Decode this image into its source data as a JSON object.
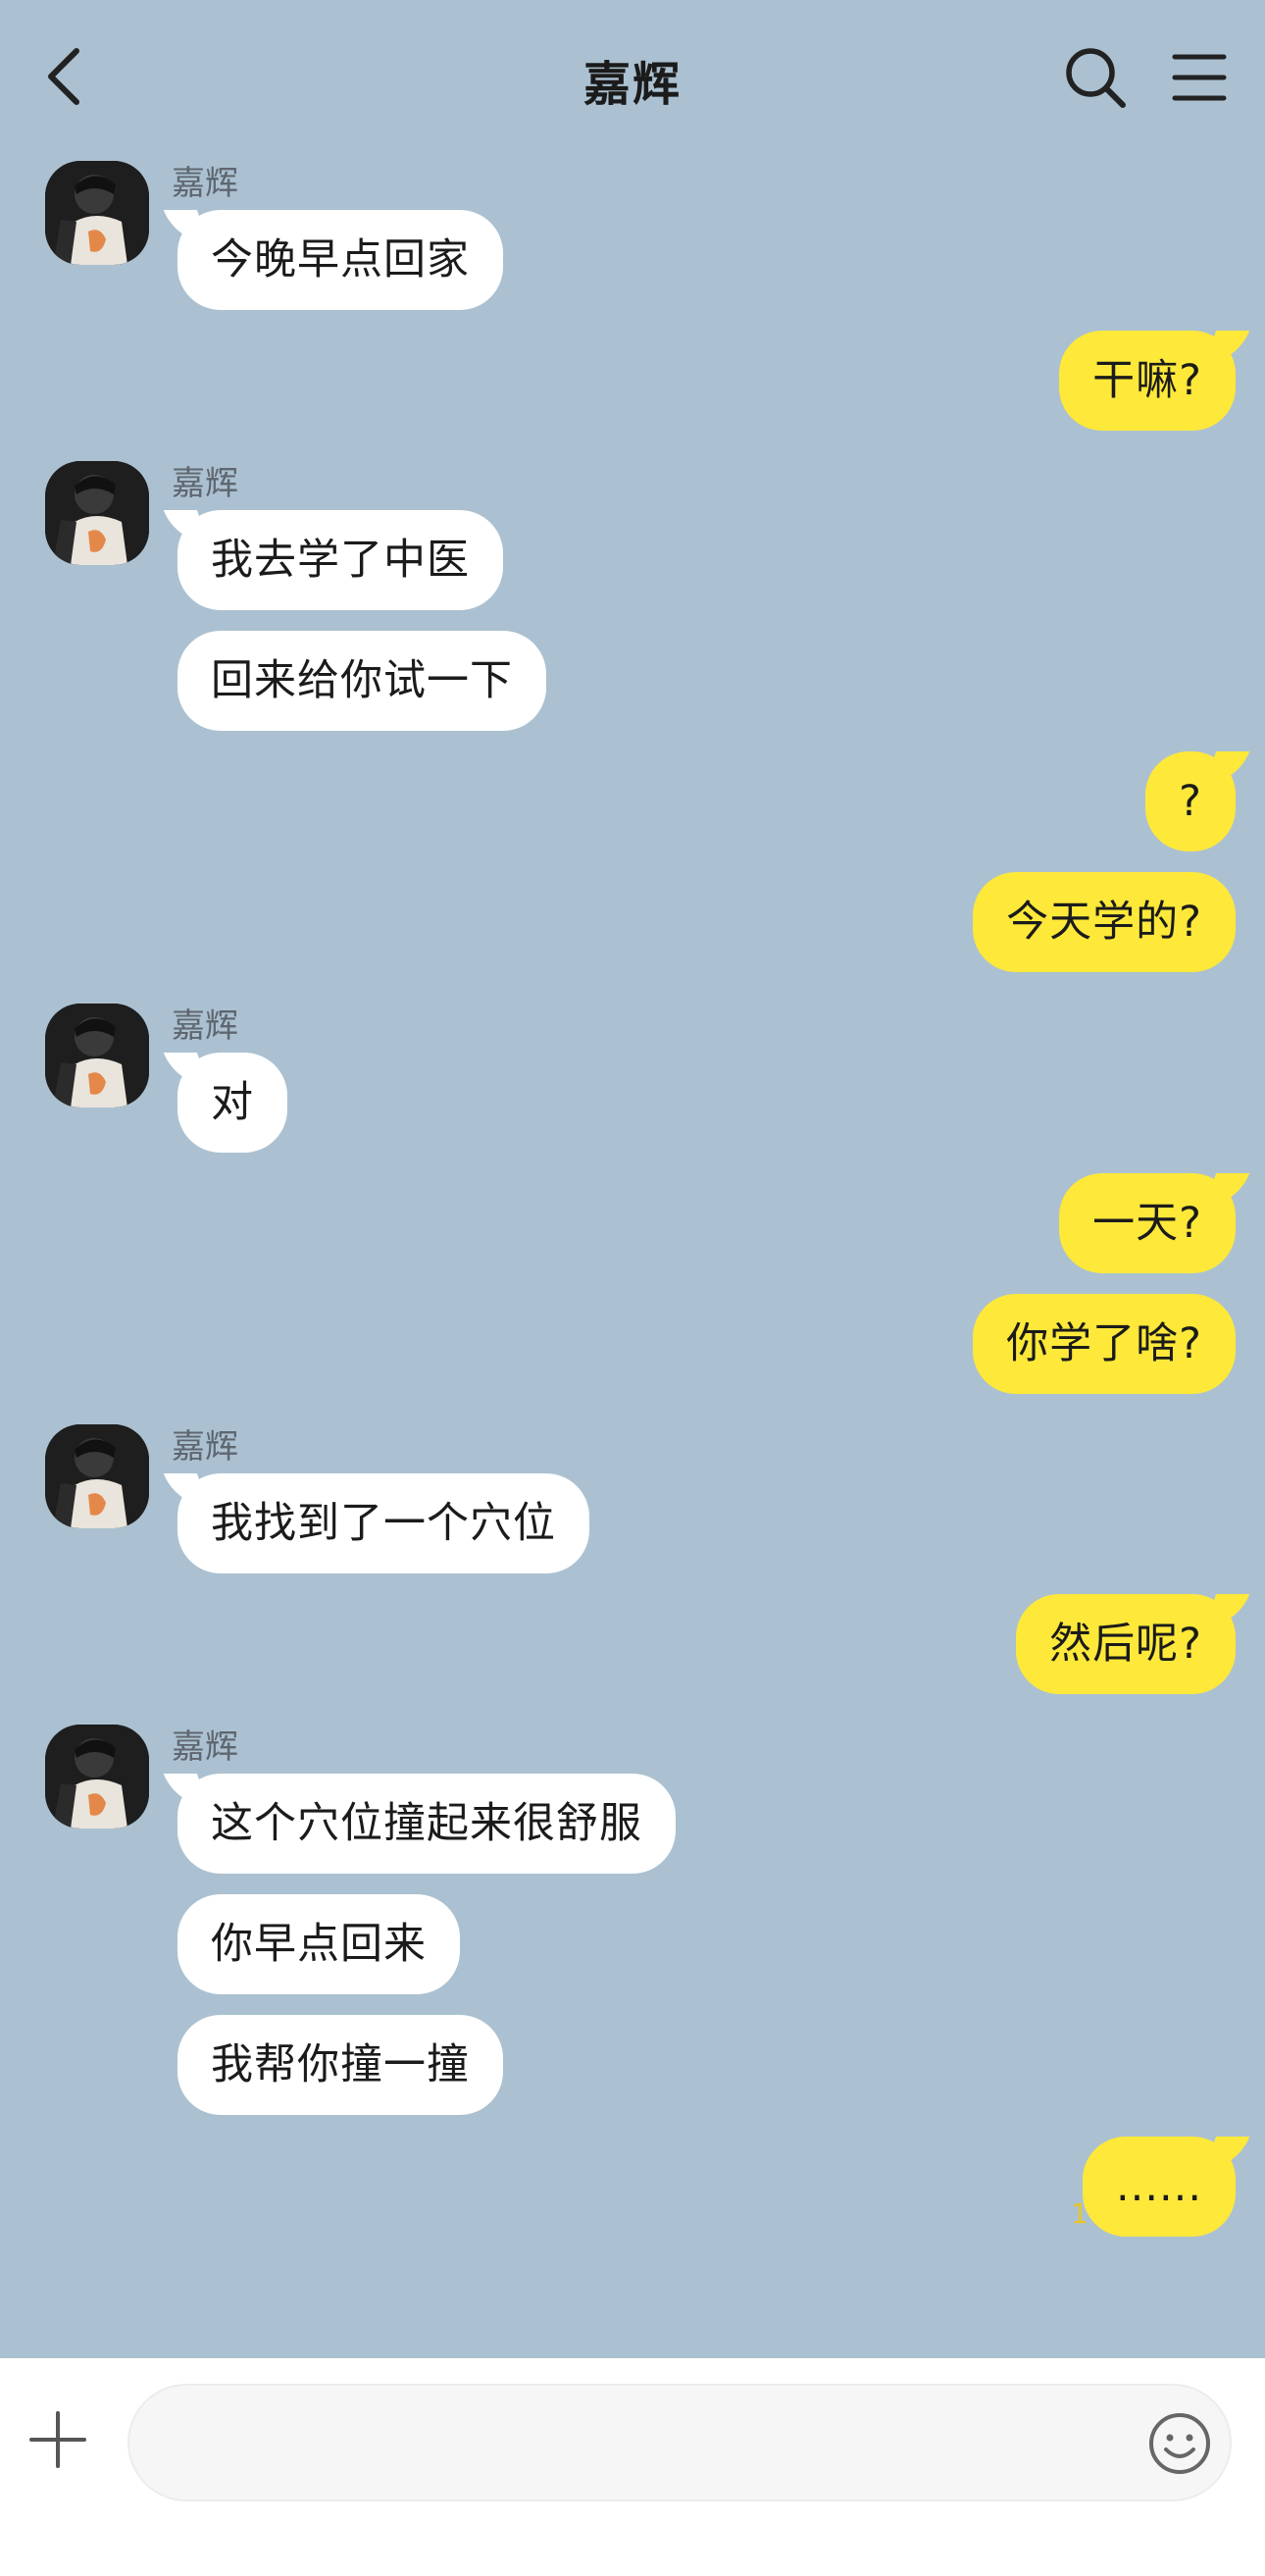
{
  "header": {
    "title": "嘉辉",
    "back_icon": "chevron-left-icon",
    "search_icon": "search-icon",
    "menu_icon": "hamburger-menu-icon"
  },
  "contact": {
    "name": "嘉辉",
    "avatar_icon": "avatar"
  },
  "messages": {
    "g1_name": "嘉辉",
    "m1": "今晚早点回家",
    "m2": "干嘛?",
    "g2_name": "嘉辉",
    "m3": "我去学了中医",
    "m4": "回来给你试一下",
    "m5": "?",
    "m6": "今天学的?",
    "g3_name": "嘉辉",
    "m7": "对",
    "m8": "一天?",
    "m9": "你学了啥?",
    "g4_name": "嘉辉",
    "m10": "我找到了一个穴位",
    "m11": "然后呢?",
    "g5_name": "嘉辉",
    "m12": "这个穴位撞起来很舒服",
    "m13": "你早点回来",
    "m14": "我帮你撞一撞",
    "m15": "......",
    "m15_unread": "1"
  },
  "input": {
    "placeholder": "",
    "attach_icon": "plus-icon",
    "emoji_icon": "emoji-icon"
  },
  "colors": {
    "background": "#abc1d1",
    "incoming_bubble": "#ffffff",
    "outgoing_bubble": "#fee83a",
    "unread": "#e8c52a"
  }
}
